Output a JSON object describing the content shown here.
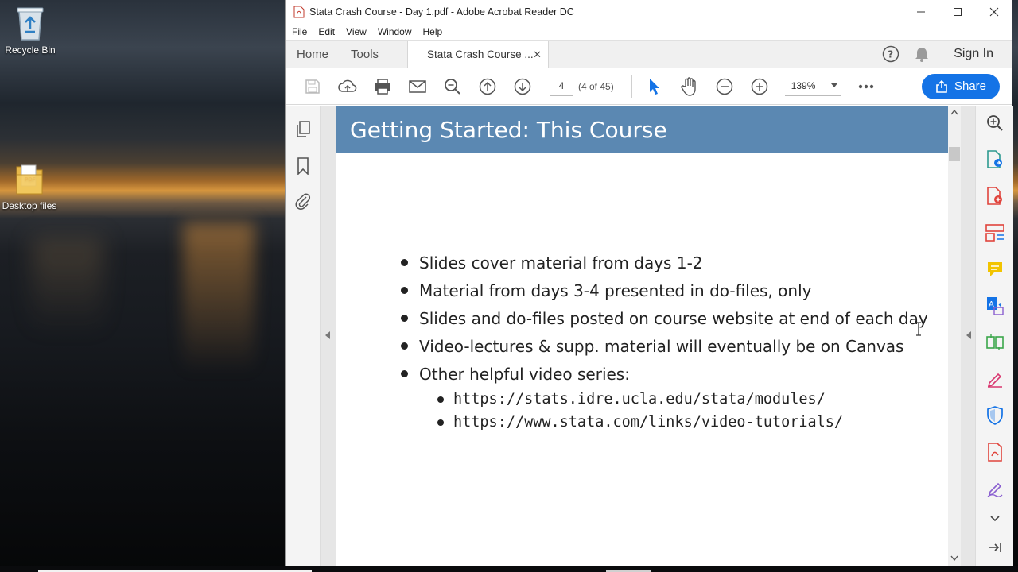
{
  "desktop": {
    "icons": [
      {
        "label": "Recycle Bin",
        "icon": "recycle-bin-icon"
      },
      {
        "label": "Desktop files",
        "icon": "folder-pdf-icon"
      }
    ]
  },
  "window": {
    "title": "Stata Crash Course - Day 1.pdf - Adobe Acrobat Reader DC",
    "menu": [
      "File",
      "Edit",
      "View",
      "Window",
      "Help"
    ]
  },
  "tabs": {
    "home": "Home",
    "tools": "Tools",
    "document": "Stata Crash Course ...",
    "sign_in": "Sign In"
  },
  "toolbar": {
    "page_number": "4",
    "page_of": "(4 of 45)",
    "zoom": "139%",
    "share_label": "Share"
  },
  "slide": {
    "title": "Getting Started: This Course",
    "bullets": [
      "Slides cover material from days 1-2",
      "Material from days 3-4 presented in do-files, only",
      "Slides and do-files posted on course website at end of each day",
      "Video-lectures & supp. material will eventually be on Canvas",
      "Other helpful video series:"
    ],
    "sub_bullets": [
      "https://stats.idre.ucla.edu/stata/modules/",
      "https://www.stata.com/links/video-tutorials/"
    ]
  },
  "colors": {
    "accent": "#1473e6",
    "slide_header": "#5b88b2"
  }
}
